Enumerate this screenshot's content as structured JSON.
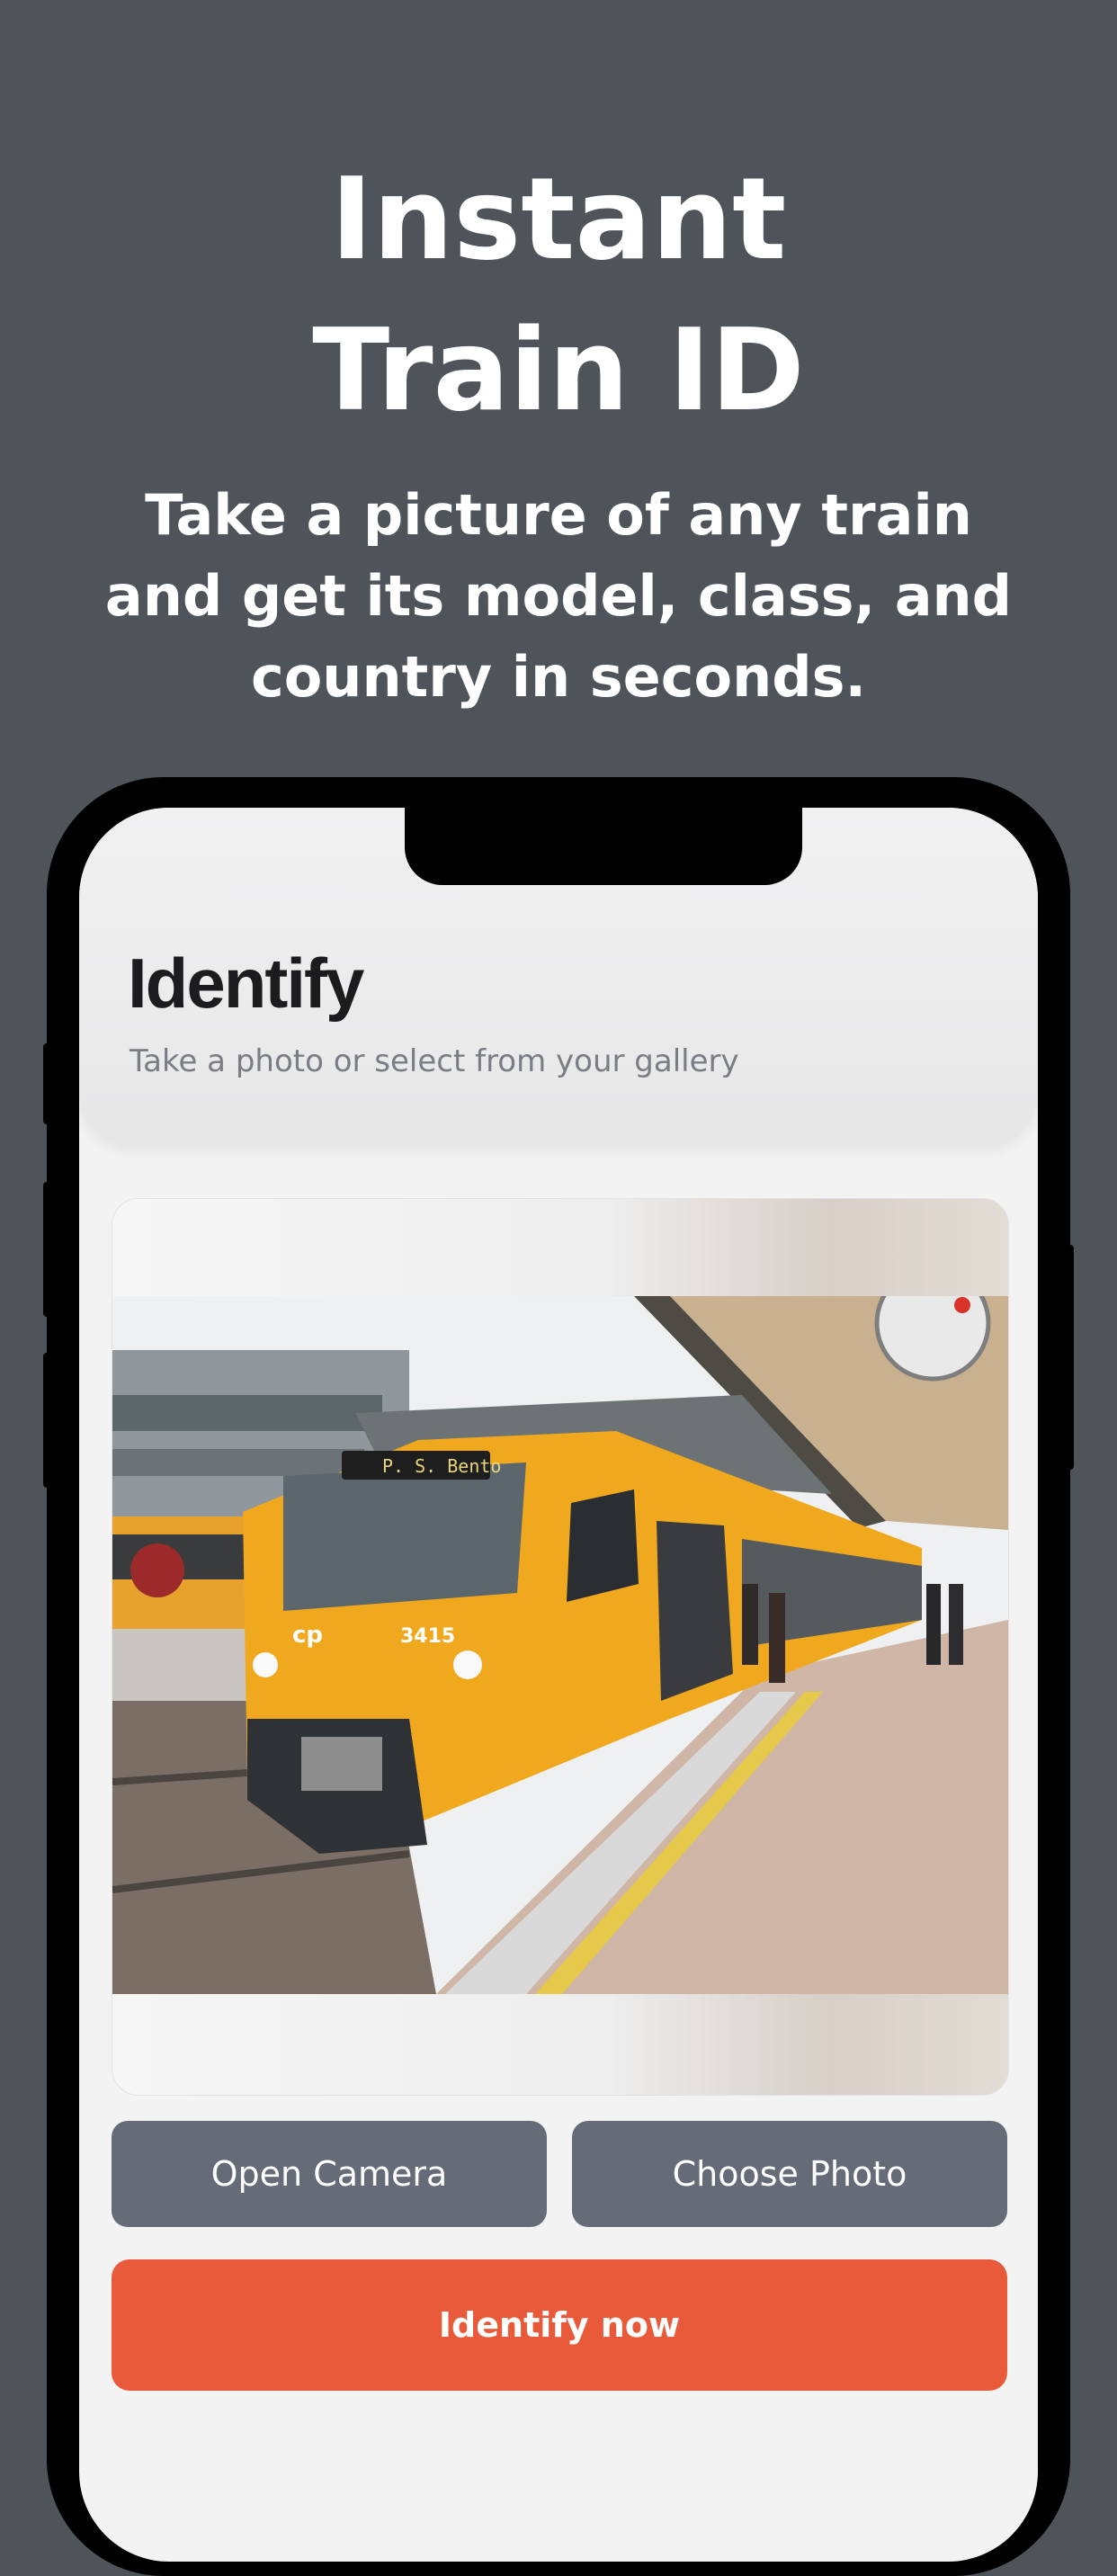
{
  "hero": {
    "headline_line1": "Instant",
    "headline_line2": "Train ID",
    "subhead_line1": "Take a picture of any train",
    "subhead_line2": "and get its model, class, and",
    "subhead_line3": "country in seconds."
  },
  "screen": {
    "title": "Identify",
    "subtitle": "Take a photo or select from your gallery",
    "photo": {
      "destination_sign": "P. S. Bento",
      "unit_number": "3415",
      "operator_logo": "cp"
    },
    "buttons": {
      "camera": "Open Camera",
      "gallery": "Choose Photo",
      "identify": "Identify now"
    }
  },
  "colors": {
    "background": "#4f535a",
    "secondary_button": "#666b78",
    "primary_button": "#e85a3a",
    "train_yellow": "#f0a91f"
  }
}
